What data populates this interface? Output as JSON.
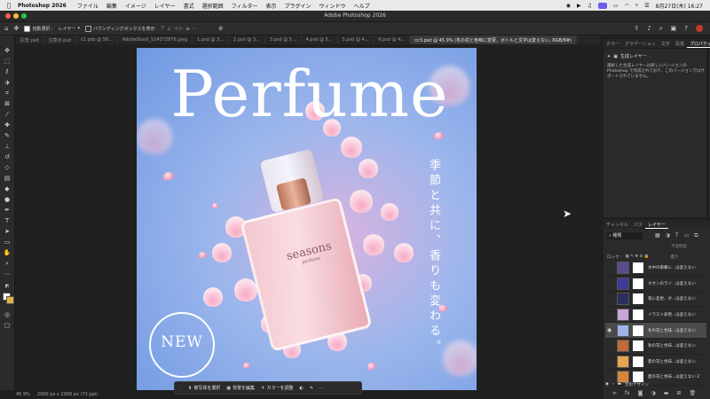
{
  "menubar": {
    "app_name": "Photoshop 2026",
    "items": [
      "ファイル",
      "編集",
      "イメージ",
      "レイヤー",
      "書式",
      "選択範囲",
      "フィルター",
      "表示",
      "プラグイン",
      "ウィンドウ",
      "ヘルプ"
    ],
    "clock": "8月27日(木) 16:27"
  },
  "window": {
    "title": "Adobe Photoshop 2026"
  },
  "options_bar": {
    "auto_select": "自動選択 :",
    "auto_select_target": "レイヤー",
    "bounding_box": "バウンディングボックスを表示"
  },
  "tabs": [
    "広告.psd",
    "注意点.psd",
    "c1.psb @ 50...",
    "AdobeStock_524372876.jpeg",
    "1.psd @ 3...",
    "2.psd @ 3...",
    "3.psd @ 5...",
    "4.psd @ 5...",
    "5.psd @ 4...",
    "6.psd @ 4...",
    "cc3.psd @ 45.9% (冬の花と色味に変更、ボトルと文字は変えない, RGB/8#)"
  ],
  "active_tab_index": 10,
  "right_tabs": [
    "カラー",
    "グラデーション",
    "文字",
    "段落",
    "プロパティ"
  ],
  "properties": {
    "heading": "生成レイヤー",
    "description": "選択した生成レイヤーは新しいバージョンの Photoshop で作成されており、このバージョンではサポートされていません。"
  },
  "canvas": {
    "headline": "Perfume",
    "vertical_copy": "季節と共に、香りも変わる。",
    "bottle_label": "seasons",
    "bottle_sublabel": "perfume",
    "badge": "NEW"
  },
  "task_bar": {
    "select_subject": "被写体を選択",
    "edit_background": "背景を編集",
    "adjust_color": "カラーを調整"
  },
  "status": {
    "zoom": "45.9%",
    "doc_info": "2000 px x 2000 px (72 ppi)"
  },
  "layers_panel": {
    "tabs": [
      "チャンネル",
      "パス",
      "レイヤー"
    ],
    "filter": "種類",
    "row_labels": [
      "不透明度",
      "塗り"
    ],
    "lock_label": "ロック :",
    "layers": [
      {
        "name": "水中の衝撃に...は変えない",
        "thumb": "#5b4a8e"
      },
      {
        "name": "ネオンのライ...は変えない",
        "thumb": "#3e3a9a"
      },
      {
        "name": "夜に変更、ボ...は変えない",
        "thumb": "#2a2e5e"
      },
      {
        "name": "イラスト表現...は変えない",
        "thumb": "#c7a6d9"
      },
      {
        "name": "冬の花と色味...は変えない",
        "thumb": "#9fb3e8"
      },
      {
        "name": "秋の花と色味...は変えない",
        "thumb": "#c06a3a"
      },
      {
        "name": "夏の花と色味...は変えない",
        "thumb": "#e3a64e"
      },
      {
        "name": "夏の花と色味...は変えない 2",
        "thumb": "#d8853c"
      }
    ],
    "selected_index": 4,
    "group_name": "元のデザイン"
  },
  "colors": {
    "accent": "#6b5cf2",
    "panel": "#2a2a2a",
    "canvas_bg": "#202020"
  }
}
